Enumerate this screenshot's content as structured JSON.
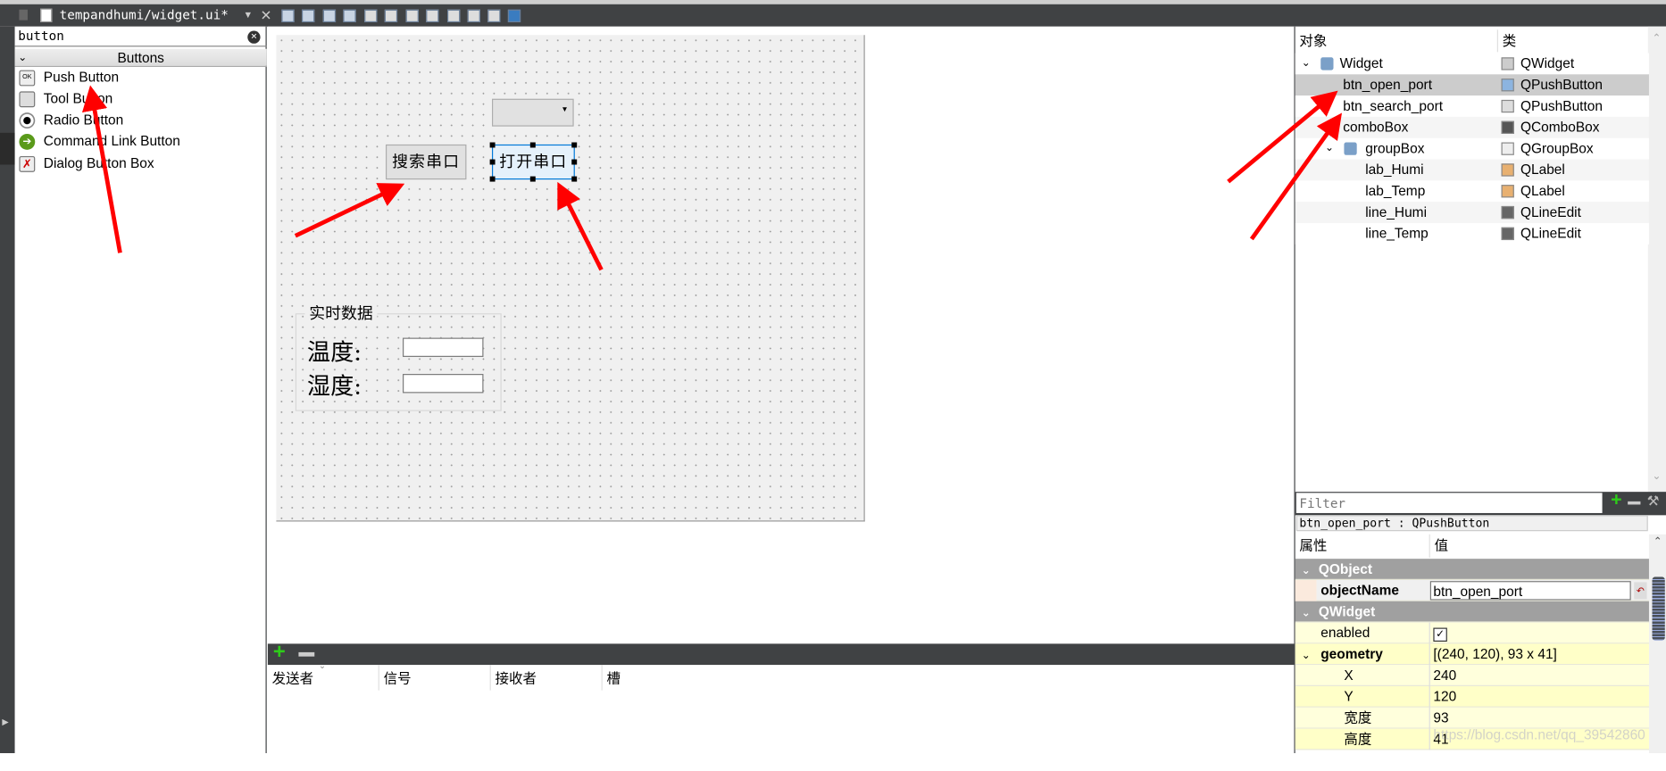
{
  "tab": {
    "title": "tempandhumi/widget.ui*"
  },
  "widget_box": {
    "search_value": "button",
    "category": "Buttons",
    "items": [
      {
        "label": "Push Button",
        "icon": "push-button-icon"
      },
      {
        "label": "Tool Button",
        "icon": "tool-button-icon"
      },
      {
        "label": "Radio Button",
        "icon": "radio-button-icon"
      },
      {
        "label": "Command Link Button",
        "icon": "command-link-icon"
      },
      {
        "label": "Dialog Button Box",
        "icon": "dialog-button-box-icon"
      }
    ]
  },
  "form": {
    "search_button": "搜索串口",
    "open_button": "打开串口",
    "group_title": "实时数据",
    "temp_label": "温度:",
    "humi_label": "湿度:"
  },
  "signal_editor": {
    "columns": [
      "发送者",
      "信号",
      "接收者",
      "槽"
    ]
  },
  "object_inspector": {
    "headers": [
      "对象",
      "类"
    ],
    "rows": [
      {
        "name": "Widget",
        "cls": "QWidget"
      },
      {
        "name": "btn_open_port",
        "cls": "QPushButton",
        "selected": true
      },
      {
        "name": "btn_search_port",
        "cls": "QPushButton"
      },
      {
        "name": "comboBox",
        "cls": "QComboBox"
      },
      {
        "name": "groupBox",
        "cls": "QGroupBox"
      },
      {
        "name": "lab_Humi",
        "cls": "QLabel"
      },
      {
        "name": "lab_Temp",
        "cls": "QLabel"
      },
      {
        "name": "line_Humi",
        "cls": "QLineEdit"
      },
      {
        "name": "line_Temp",
        "cls": "QLineEdit"
      }
    ]
  },
  "property_editor": {
    "filter_placeholder": "Filter",
    "object_label": "btn_open_port : QPushButton",
    "headers": [
      "属性",
      "值"
    ],
    "groups": {
      "qobject": "QObject",
      "qwidget": "QWidget"
    },
    "object_name": {
      "label": "objectName",
      "value": "btn_open_port"
    },
    "enabled": {
      "label": "enabled",
      "checked": true
    },
    "geometry": {
      "label": "geometry",
      "value": "[(240, 120), 93 x 41]",
      "x_label": "X",
      "x": "240",
      "y_label": "Y",
      "y": "120",
      "w_label": "宽度",
      "w": "93",
      "h_label": "高度",
      "h": "41"
    }
  },
  "watermark": "https://blog.csdn.net/qq_39542860",
  "colors": {
    "annotation_arrow": "#ff0000",
    "selection": "#cccccc",
    "group_header": "#a0a0a0",
    "property_row": "#ffffdc"
  }
}
